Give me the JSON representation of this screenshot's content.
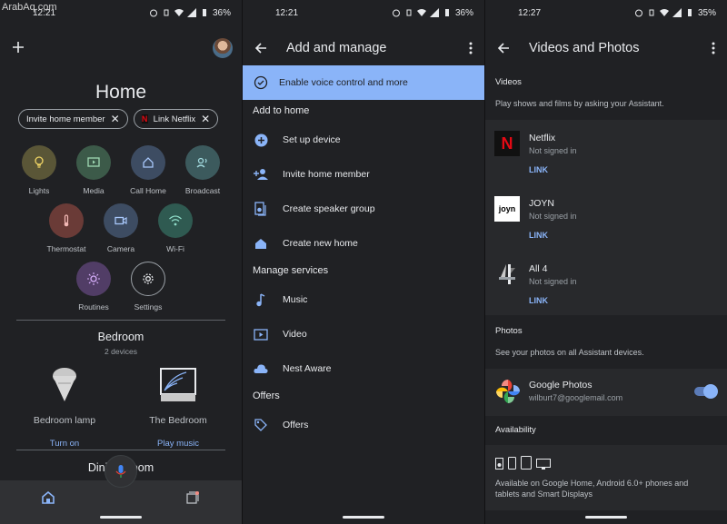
{
  "watermark": "ArabAq.com",
  "screen1": {
    "status": {
      "time": "12:21",
      "battery": "36%"
    },
    "title": "Home",
    "chips": [
      {
        "label": "Invite home member"
      },
      {
        "label": "Link Netflix"
      }
    ],
    "tiles": [
      {
        "label": "Lights",
        "icon": "bulb-icon",
        "color": "#5a5637"
      },
      {
        "label": "Media",
        "icon": "media-icon",
        "color": "#3c5a49"
      },
      {
        "label": "Call Home",
        "icon": "call-home-icon",
        "color": "#3d4c62"
      },
      {
        "label": "Broadcast",
        "icon": "broadcast-icon",
        "color": "#3c5a5d"
      },
      {
        "label": "Thermostat",
        "icon": "thermostat-icon",
        "color": "#6a3b37"
      },
      {
        "label": "Camera",
        "icon": "camera-icon",
        "color": "#3d4c62"
      },
      {
        "label": "Wi-Fi",
        "icon": "wifi-icon",
        "color": "#2f5a51"
      },
      {
        "label": "Routines",
        "icon": "routines-icon",
        "color": "#513d66"
      },
      {
        "label": "Settings",
        "icon": "settings-icon",
        "color": "#202124"
      }
    ],
    "room": {
      "name": "Bedroom",
      "sub": "2 devices"
    },
    "devices": [
      {
        "name": "Bedroom lamp",
        "action": "Turn on"
      },
      {
        "name": "The Bedroom",
        "action": "Play music"
      }
    ],
    "next_room": "Dining Room"
  },
  "screen2": {
    "status": {
      "time": "12:21",
      "battery": "36%"
    },
    "title": "Add and manage",
    "banner": "Enable voice control and more",
    "sections": {
      "add": "Add to home",
      "manage": "Manage services",
      "offers": "Offers"
    },
    "add_items": [
      "Set up device",
      "Invite home member",
      "Create speaker group",
      "Create new home"
    ],
    "manage_items": [
      "Music",
      "Video",
      "Nest Aware"
    ],
    "offer_items": [
      "Offers"
    ]
  },
  "screen3": {
    "status": {
      "time": "12:27",
      "battery": "35%"
    },
    "title": "Videos and Photos",
    "videos": {
      "header": "Videos",
      "desc": "Play shows and films by asking your Assistant.",
      "services": [
        {
          "name": "Netflix",
          "status": "Not signed in",
          "link": "LINK"
        },
        {
          "name": "JOYN",
          "status": "Not signed in",
          "link": "LINK"
        },
        {
          "name": "All 4",
          "status": "Not signed in",
          "link": "LINK"
        }
      ]
    },
    "photos": {
      "header": "Photos",
      "desc": "See your photos on all Assistant devices.",
      "app": "Google Photos",
      "account": "wilburt7@googlemail.com",
      "toggle_on": true
    },
    "availability": {
      "header": "Availability",
      "text_line1": "Available on Google Home, Android 6.0+ phones and",
      "text_line2": "tablets and Smart Displays"
    }
  }
}
